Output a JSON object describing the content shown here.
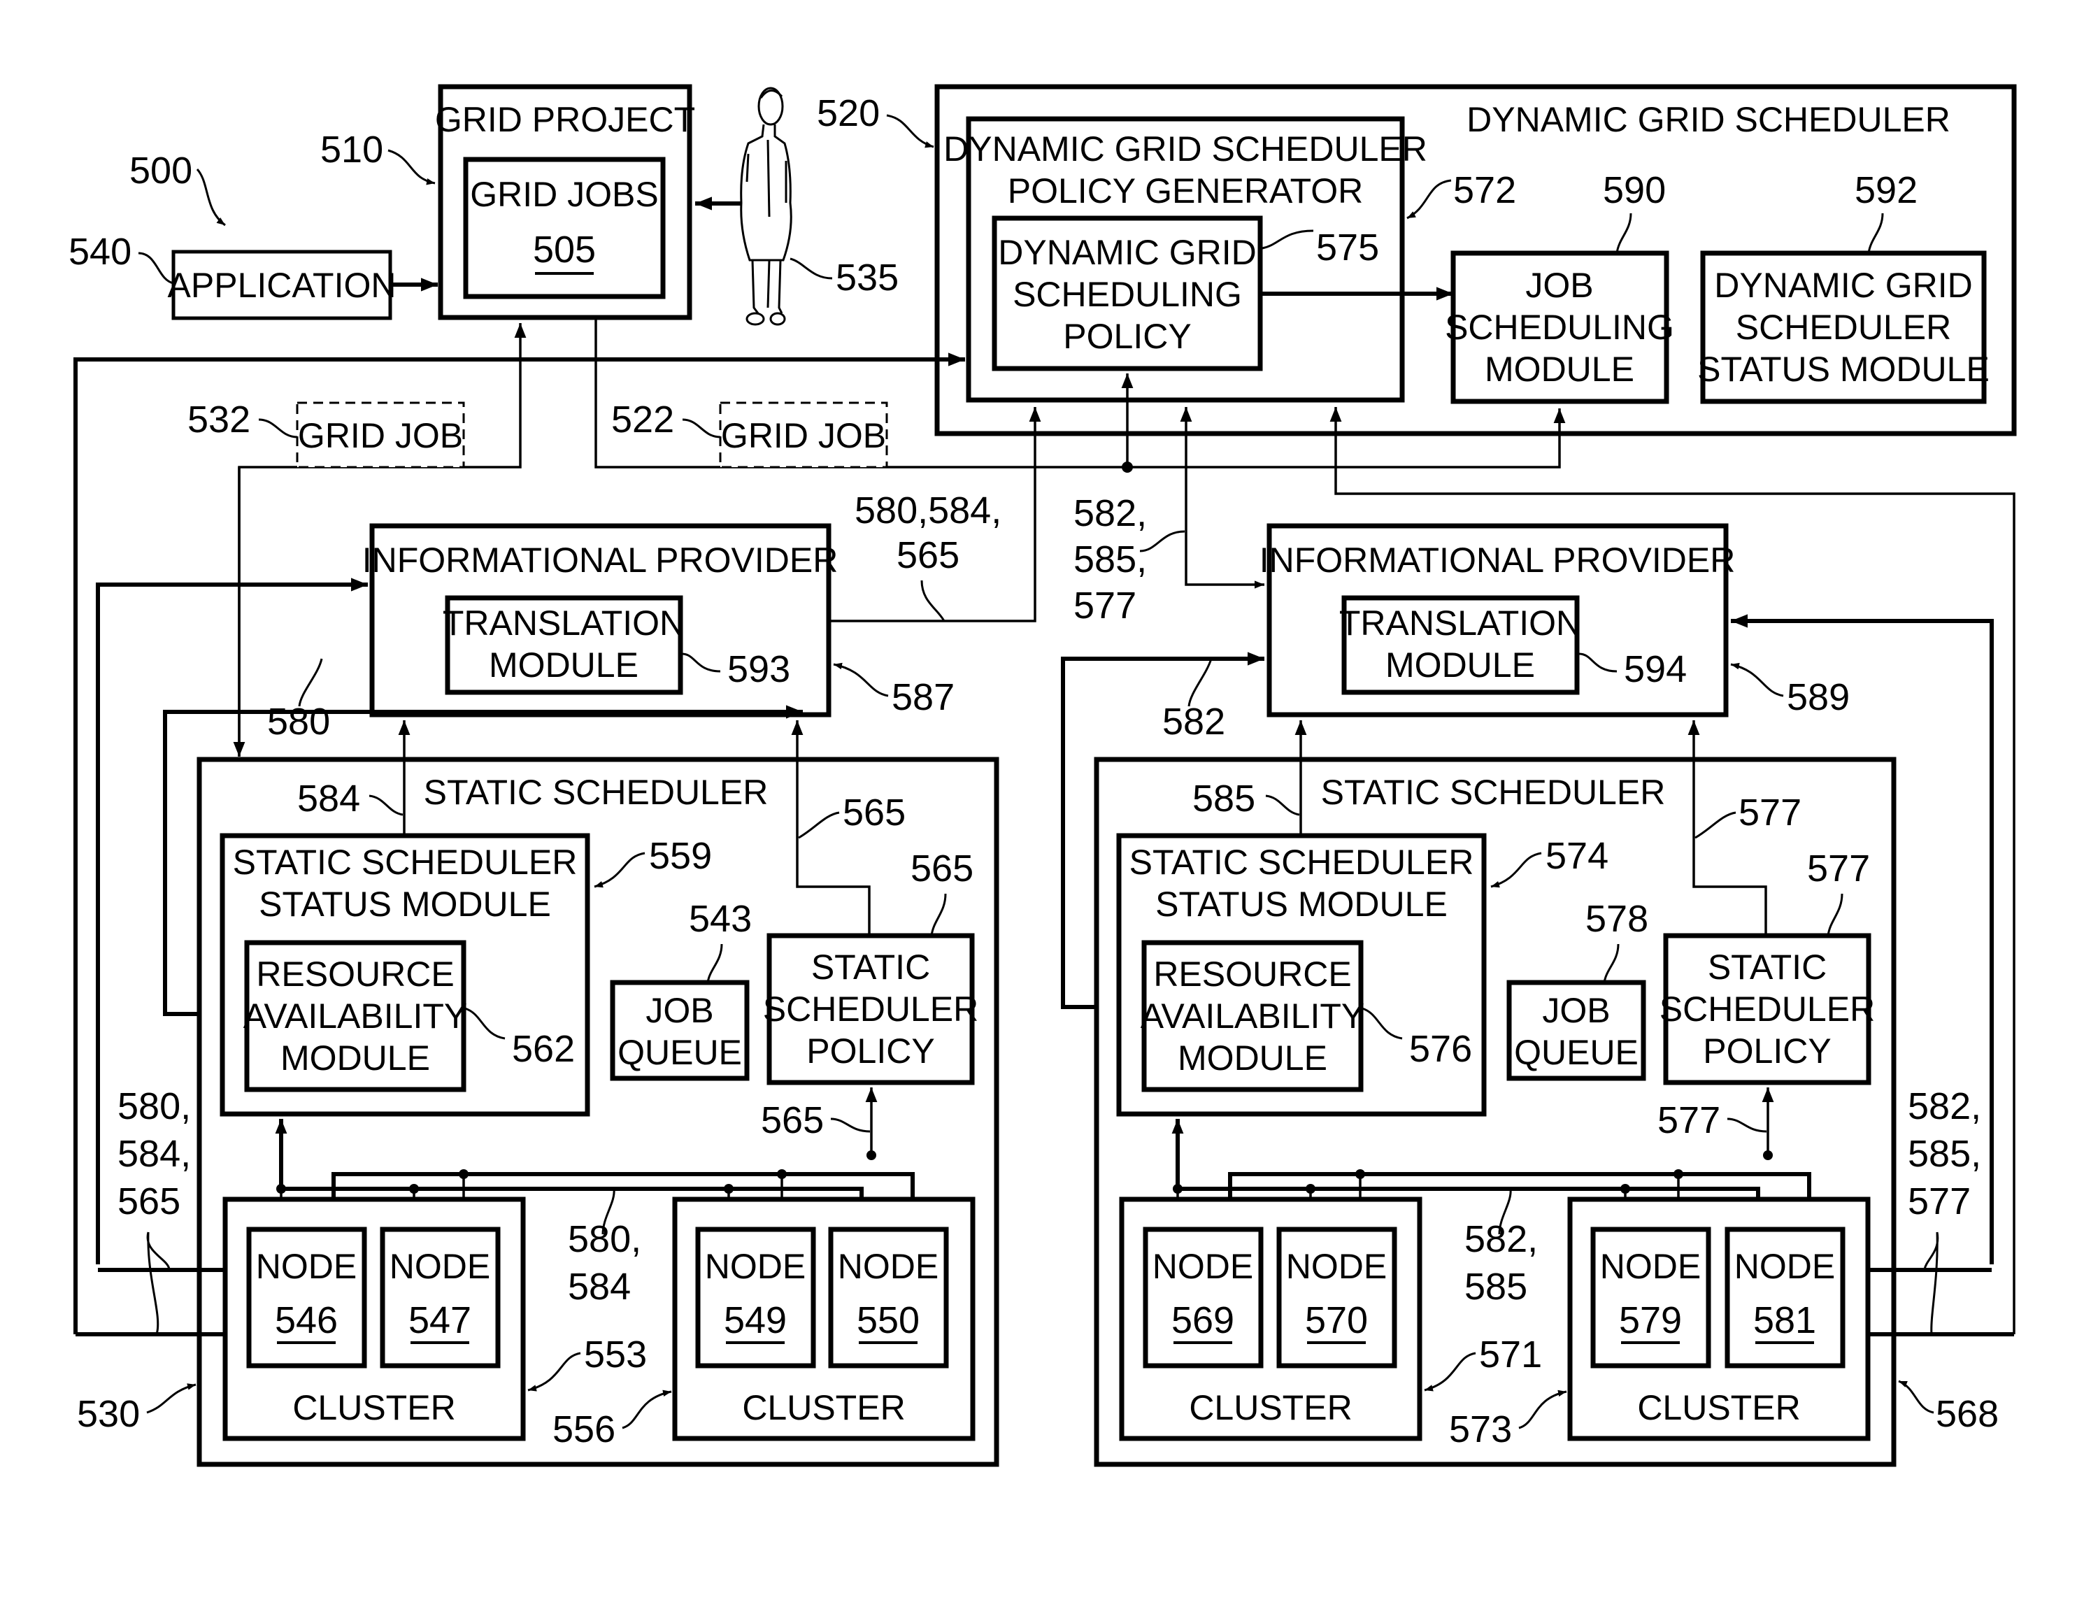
{
  "figure": {
    "ref": "500",
    "application": {
      "label": "APPLICATION",
      "ref": "540"
    },
    "grid_project": {
      "label": "GRID PROJECT",
      "ref": "510",
      "grid_jobs": {
        "label": "GRID JOBS",
        "ref": "505"
      }
    },
    "user": {
      "icon": "person-icon",
      "ref": "535"
    },
    "grid_job_left": {
      "label": "GRID JOB",
      "ref": "532"
    },
    "grid_job_right": {
      "label": "GRID JOB",
      "ref": "522"
    },
    "dynamic_grid_scheduler": {
      "label": "DYNAMIC GRID SCHEDULER",
      "ref": "520",
      "policy_generator": {
        "line1": "DYNAMIC GRID SCHEDULER",
        "line2": "POLICY GENERATOR",
        "ref": "572",
        "policy": {
          "line1": "DYNAMIC GRID",
          "line2": "SCHEDULING",
          "line3": "POLICY",
          "ref": "575"
        }
      },
      "job_scheduling_module": {
        "line1": "JOB",
        "line2": "SCHEDULING",
        "line3": "MODULE",
        "ref": "590"
      },
      "status_module": {
        "line1": "DYNAMIC GRID",
        "line2": "SCHEDULER",
        "line3": "STATUS MODULE",
        "ref": "592"
      }
    },
    "info_provider_left": {
      "label": "INFORMATIONAL PROVIDER",
      "ref": "587",
      "translation": {
        "line1": "TRANSLATION",
        "line2": "MODULE",
        "ref": "593"
      },
      "link_label_1": "580,584,",
      "link_label_2": "565",
      "link_in_label": "580"
    },
    "info_provider_right": {
      "label": "INFORMATIONAL PROVIDER",
      "ref": "589",
      "translation": {
        "line1": "TRANSLATION",
        "line2": "MODULE",
        "ref": "594"
      },
      "link_label_1": "582,",
      "link_label_2": "585,",
      "link_label_3": "577",
      "link_in_label": "582"
    },
    "static_scheduler_left": {
      "label": "STATIC SCHEDULER",
      "ref": "530",
      "status_link_ref": "584",
      "policy_link_ref": "565",
      "status_module": {
        "line1": "STATIC SCHEDULER",
        "line2": "STATUS MODULE",
        "ref": "559"
      },
      "resource_module": {
        "line1": "RESOURCE",
        "line2": "AVAILABILITY",
        "line3": "MODULE",
        "ref": "562"
      },
      "job_queue": {
        "line1": "JOB",
        "line2": "QUEUE",
        "ref": "543"
      },
      "policy": {
        "line1": "STATIC",
        "line2": "SCHEDULER",
        "line3": "POLICY",
        "ref": "565"
      },
      "bus_policy_ref": "565",
      "bus_label_1": "580,",
      "bus_label_2": "584",
      "side_label_1": "580,",
      "side_label_2": "584,",
      "side_label_3": "565",
      "clusters": [
        {
          "label": "CLUSTER",
          "ref": "553",
          "nodes": [
            {
              "label": "NODE",
              "ref": "546"
            },
            {
              "label": "NODE",
              "ref": "547"
            }
          ]
        },
        {
          "label": "CLUSTER",
          "ref": "556",
          "nodes": [
            {
              "label": "NODE",
              "ref": "549"
            },
            {
              "label": "NODE",
              "ref": "550"
            }
          ]
        }
      ]
    },
    "static_scheduler_right": {
      "label": "STATIC SCHEDULER",
      "ref": "568",
      "status_link_ref": "585",
      "policy_link_ref": "577",
      "status_module": {
        "line1": "STATIC SCHEDULER",
        "line2": "STATUS MODULE",
        "ref": "574"
      },
      "resource_module": {
        "line1": "RESOURCE",
        "line2": "AVAILABILITY",
        "line3": "MODULE",
        "ref": "576"
      },
      "job_queue": {
        "line1": "JOB",
        "line2": "QUEUE",
        "ref": "578"
      },
      "policy": {
        "line1": "STATIC",
        "line2": "SCHEDULER",
        "line3": "POLICY",
        "ref": "577"
      },
      "bus_policy_ref": "577",
      "bus_label_1": "582,",
      "bus_label_2": "585",
      "side_label_1": "582,",
      "side_label_2": "585,",
      "side_label_3": "577",
      "clusters": [
        {
          "label": "CLUSTER",
          "ref": "571",
          "nodes": [
            {
              "label": "NODE",
              "ref": "569"
            },
            {
              "label": "NODE",
              "ref": "570"
            }
          ]
        },
        {
          "label": "CLUSTER",
          "ref": "573",
          "nodes": [
            {
              "label": "NODE",
              "ref": "579"
            },
            {
              "label": "NODE",
              "ref": "581"
            }
          ]
        }
      ]
    }
  }
}
